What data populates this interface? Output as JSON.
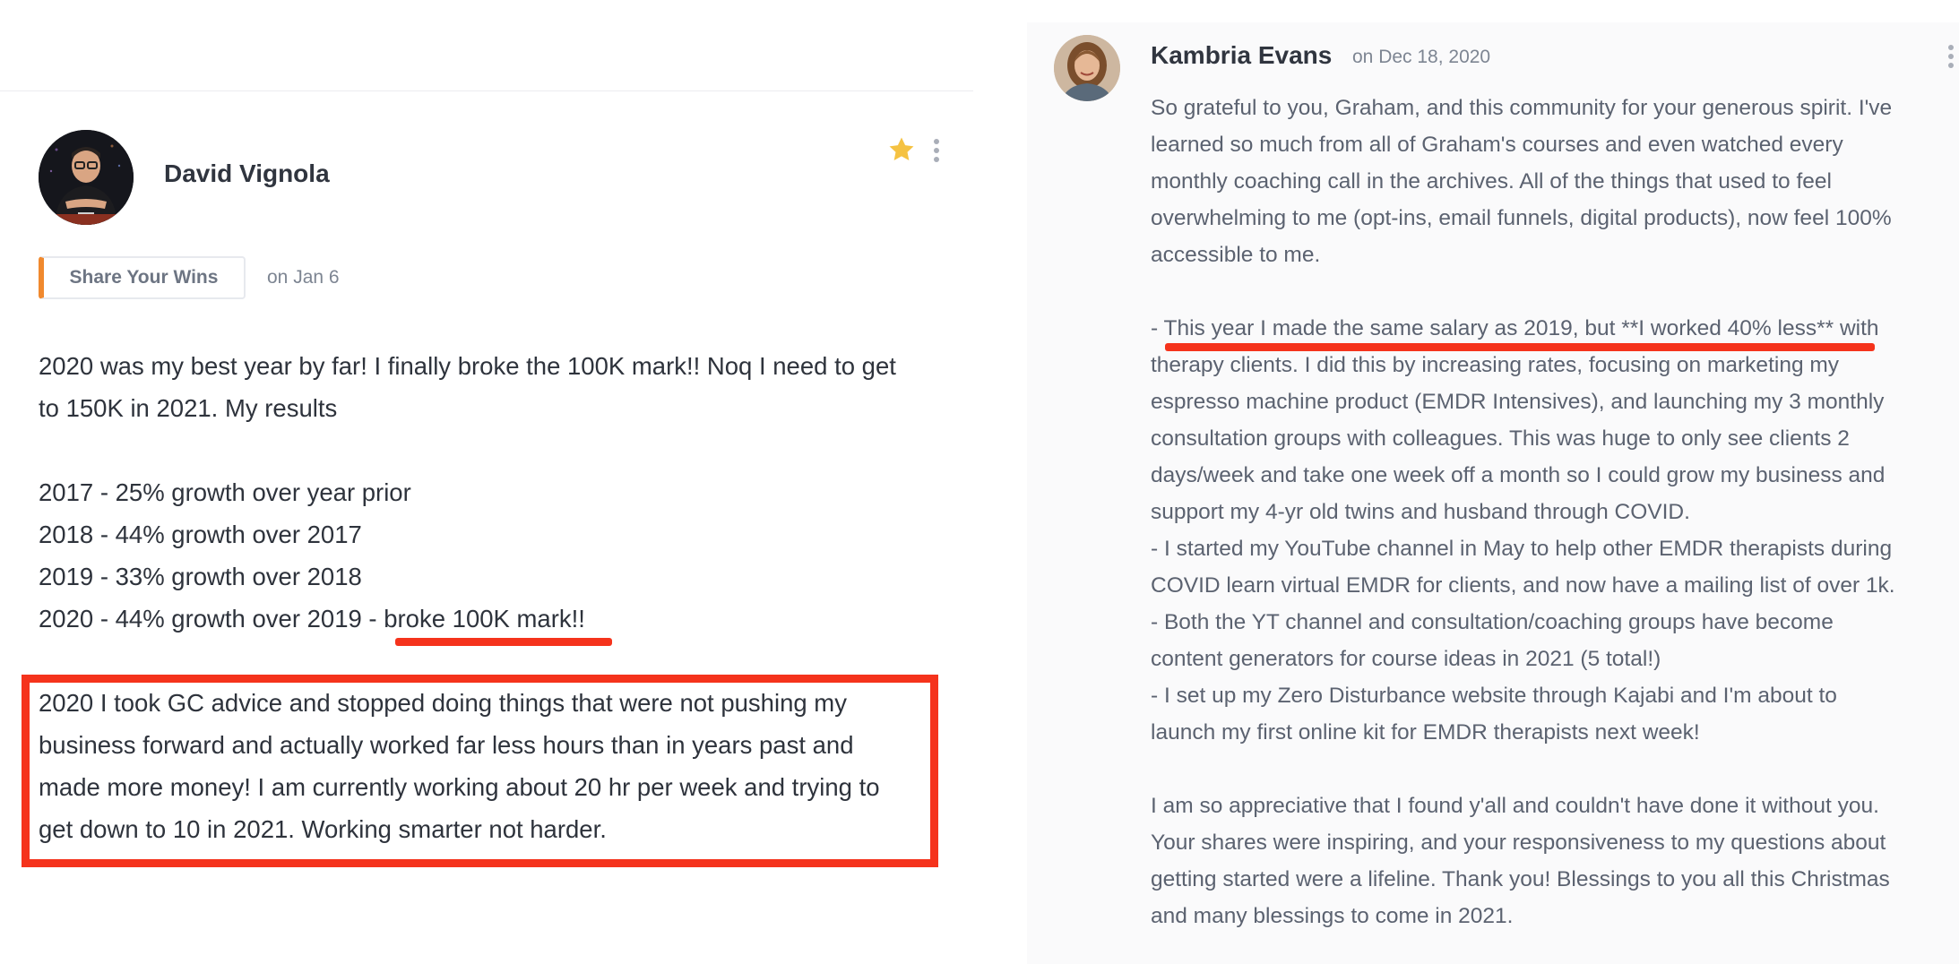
{
  "left_post": {
    "author_name": "David Vignola",
    "category_label": "Share Your Wins",
    "date": "on Jan 6",
    "starred_color": "#f5c242",
    "intro_lines": [
      "2020 was my best year by far! I finally broke the 100K mark!! Noq I need to get",
      "to 150K in 2021. My results"
    ],
    "results": [
      "2017 - 25% growth over year prior",
      "2018 - 44% growth over 2017",
      "2019 - 33% growth over 2018",
      "2020 - 44% growth over 2019 - broke 100K mark!!"
    ],
    "highlighted_lines": [
      "2020 I took GC advice and stopped doing things that were not pushing my",
      "business forward and actually worked far less hours than in years past and",
      "made more money! I am currently working about 20 hr per week and trying to",
      "get down to 10 in 2021. Working smarter not harder."
    ]
  },
  "right_post": {
    "author_name": "Kambria Evans",
    "date": "on Dec 18, 2020",
    "body_lines": [
      "So grateful to you, Graham, and this community for your generous spirit. I've",
      "learned so much from all of Graham's courses and even watched every",
      "monthly coaching call in the archives. All of the things that used to feel",
      "overwhelming to me (opt-ins, email funnels, digital products), now feel 100%",
      "accessible to me.",
      "",
      "- This year I made the same salary as 2019, but **I worked 40% less** with",
      "therapy clients. I did this by increasing rates, focusing on marketing my",
      "espresso machine product (EMDR Intensives), and launching my 3 monthly",
      "consultation groups with colleagues. This was huge to only see clients 2",
      "days/week and take one week off a month so I could grow my business and",
      "support my 4-yr old twins and husband through COVID.",
      "- I started my YouTube channel in May to help other EMDR therapists during",
      "COVID learn virtual EMDR for clients, and now have a mailing list of over 1k.",
      "- Both the YT channel and consultation/coaching groups have become",
      "content generators for course ideas in 2021 (5 total!)",
      "- I set up my Zero Disturbance website through Kajabi and I'm about to",
      "launch my first online kit for EMDR therapists next week!",
      "",
      "I am so appreciative that I found y'all and couldn't have done it without you.",
      "Your shares were inspiring, and your responsiveness to my questions about",
      "getting started were a lifeline. Thank you! Blessings to you all this Christmas",
      "and many blessings to come in 2021."
    ]
  },
  "colors": {
    "annotation_red": "#f5331c",
    "category_accent": "#f0892e"
  }
}
